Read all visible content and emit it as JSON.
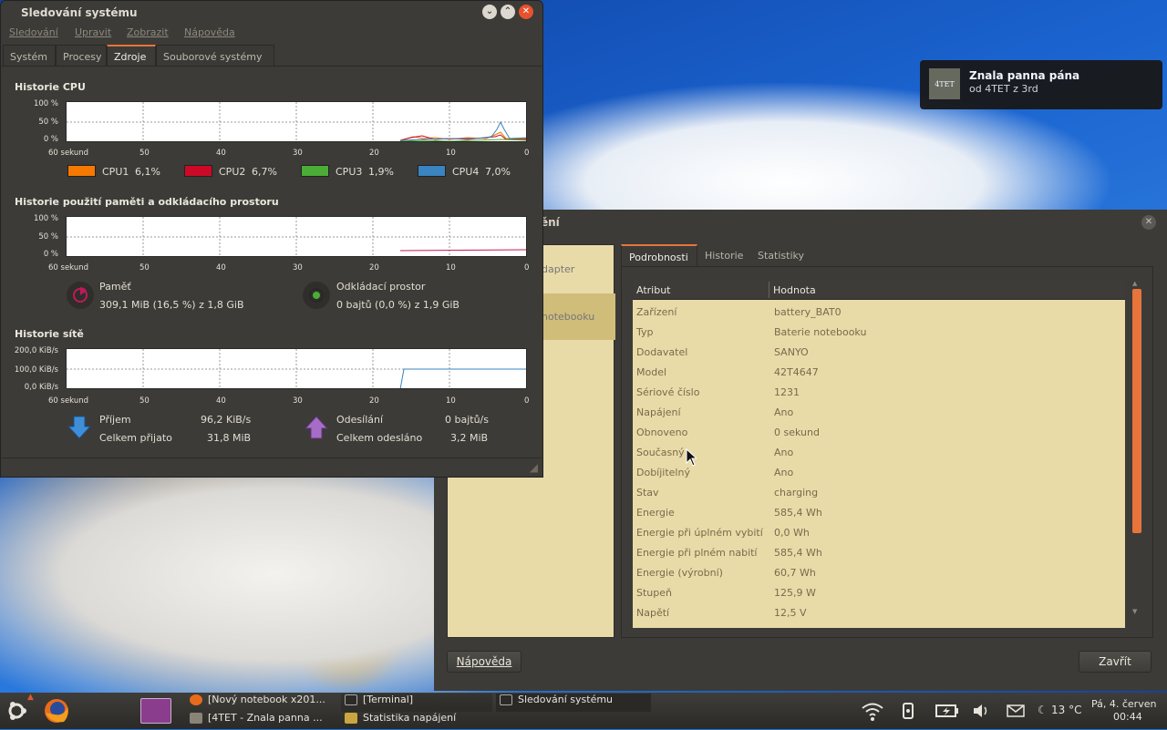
{
  "notification": {
    "thumb_text": "4TET",
    "title": "Znala panna pána",
    "body": "od 4TET z 3rd"
  },
  "monitor": {
    "title": "Sledování systému",
    "menu": [
      "Sledování",
      "Upravit",
      "Zobrazit",
      "Nápověda"
    ],
    "tabs": [
      "Systém",
      "Procesy",
      "Zdroje",
      "Souborové systémy"
    ],
    "active_tab": "Zdroje",
    "cpu": {
      "heading": "Historie CPU",
      "y_ticks": [
        "100 %",
        "50 %",
        "0 %"
      ],
      "x_ticks": [
        "60 sekund",
        "50",
        "40",
        "30",
        "20",
        "10",
        "0"
      ],
      "legend": [
        {
          "label": "CPU1",
          "value": "6,1%",
          "color": "#f57900"
        },
        {
          "label": "CPU2",
          "value": "6,7%",
          "color": "#cc0a27"
        },
        {
          "label": "CPU3",
          "value": "1,9%",
          "color": "#4bad36"
        },
        {
          "label": "CPU4",
          "value": "7,0%",
          "color": "#3a84c0"
        }
      ]
    },
    "mem": {
      "heading": "Historie použití paměti a odkládacího prostoru",
      "y_ticks": [
        "100 %",
        "50 %",
        "0 %"
      ],
      "x_ticks": [
        "60 sekund",
        "50",
        "40",
        "30",
        "20",
        "10",
        "0"
      ],
      "memory_label": "Paměť",
      "memory_value": "309,1 MiB (16,5 %) z 1,8 GiB",
      "swap_label": "Odkládací prostor",
      "swap_value": "0 bajtů (0,0 %) z 1,9 GiB"
    },
    "net": {
      "heading": "Historie sítě",
      "y_ticks": [
        "200,0 KiB/s",
        "100,0 KiB/s",
        "0,0 KiB/s"
      ],
      "x_ticks": [
        "60 sekund",
        "50",
        "40",
        "30",
        "20",
        "10",
        "0"
      ],
      "recv_label": "Příjem",
      "recv_value": "96,2 KiB/s",
      "recv_total_label": "Celkem přijato",
      "recv_total_value": "31,8 MiB",
      "send_label": "Odesílání",
      "send_value": "0 bajtů/s",
      "send_total_label": "Celkem odesláno",
      "send_total_value": "3,2 MiB"
    }
  },
  "power": {
    "title_fragment": "ění",
    "devices": [
      "dapter",
      "notebooku"
    ],
    "tabs": [
      "Podrobnosti",
      "Historie",
      "Statistiky"
    ],
    "col_attr": "Atribut",
    "col_value": "Hodnota",
    "rows": [
      [
        "Zařízení",
        "battery_BAT0"
      ],
      [
        "Typ",
        "Baterie notebooku"
      ],
      [
        "Dodavatel",
        "SANYO"
      ],
      [
        "Model",
        "42T4647"
      ],
      [
        "Sériové číslo",
        "1231"
      ],
      [
        "Napájení",
        "Ano"
      ],
      [
        "Obnoveno",
        "0 sekund"
      ],
      [
        "Současný",
        "Ano"
      ],
      [
        "Dobíjitelný",
        "Ano"
      ],
      [
        "Stav",
        "charging"
      ],
      [
        "Energie",
        "585,4 Wh"
      ],
      [
        "Energie při úplném vybití",
        "0,0 Wh"
      ],
      [
        "Energie při plném nabití",
        "585,4 Wh"
      ],
      [
        "Energie (výrobní)",
        "60,7 Wh"
      ],
      [
        "Stupeň",
        "125,9 W"
      ],
      [
        "Napětí",
        "12,5 V"
      ]
    ],
    "help_button": "Nápověda",
    "close_button": "Zavřít"
  },
  "panel": {
    "tasks": [
      "[Nový notebook x201...",
      "[4TET - Znala panna ...",
      "[Terminal]",
      "Statistika napájení",
      "Sledování systému"
    ],
    "temperature": "13 °C",
    "date": "Pá,  4. červen",
    "time": "00:44"
  }
}
